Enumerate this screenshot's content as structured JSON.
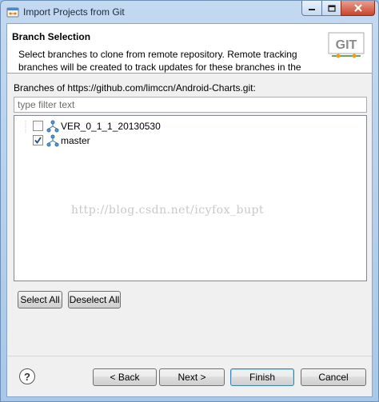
{
  "window": {
    "title": "Import Projects from Git"
  },
  "header": {
    "title": "Branch Selection",
    "description_line1": "Select branches to clone from remote repository. Remote tracking",
    "description_line2": "branches will be created to track updates for these branches in the",
    "logo_text": "GIT"
  },
  "branches": {
    "label": "Branches of https://github.com/limccn/Android-Charts.git:",
    "filter_placeholder": "type filter text",
    "items": [
      {
        "label": "VER_0_1_1_20130530",
        "checked": false
      },
      {
        "label": "master",
        "checked": true
      }
    ]
  },
  "watermark": "http://blog.csdn.net/icyfox_bupt",
  "buttons": {
    "select_all": "Select All",
    "deselect_all": "Deselect All",
    "back": "< Back",
    "next": "Next >",
    "finish": "Finish",
    "cancel": "Cancel"
  },
  "icons": {
    "app": "git-app-icon",
    "branch": "branch-icon",
    "help": "help-icon",
    "minimize": "minimize-icon",
    "maximize": "maximize-icon",
    "close": "close-icon"
  },
  "colors": {
    "title_bar": "#b9d3ee",
    "close_button": "#c8442c",
    "default_button_border": "#3c7fb1"
  }
}
